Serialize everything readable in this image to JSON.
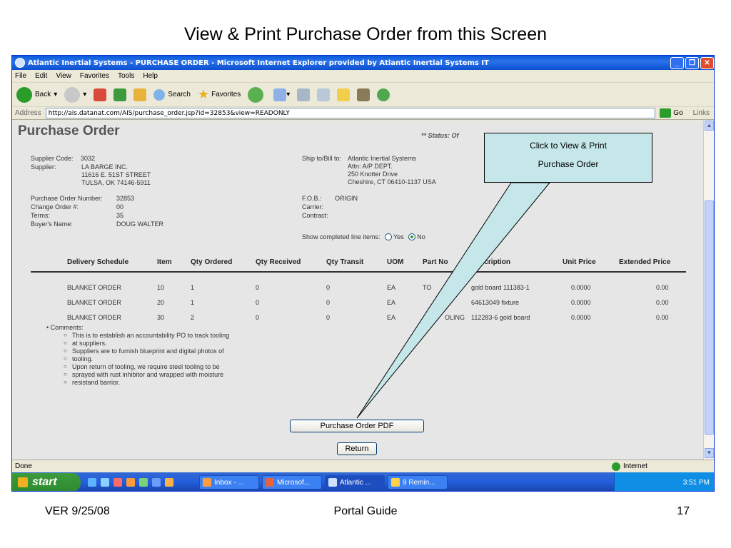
{
  "slide": {
    "title": "View & Print Purchase Order from this Screen",
    "footer_left": "VER 9/25/08",
    "footer_center": "Portal Guide",
    "footer_right": "17"
  },
  "window": {
    "title": "Atlantic Inertial Systems - PURCHASE ORDER - Microsoft Internet Explorer provided by Atlantic Inertial Systems IT"
  },
  "menu": [
    "File",
    "Edit",
    "View",
    "Favorites",
    "Tools",
    "Help"
  ],
  "toolbar": {
    "back": "Back",
    "search": "Search",
    "favorites": "Favorites"
  },
  "address": {
    "label": "Address",
    "url": "http://ais.datanat.com/AIS/purchase_order.jsp?id=32853&view=READONLY",
    "go": "Go",
    "links": "Links"
  },
  "po": {
    "heading": "Purchase Order",
    "status": "** Status: Of",
    "supplier_code_label": "Supplier Code:",
    "supplier_code": "3032",
    "supplier_label": "Supplier:",
    "supplier_lines": [
      "LA BARGE INC.",
      "11616 E. 51ST STREET",
      "TULSA, OK 74146-5911"
    ],
    "ship_label": "Ship to/Bill to:",
    "ship_lines": [
      "Atlantic Inertial Systems",
      "Attn: A/P DEPT.",
      "250 Knotter Drive",
      "Cheshire, CT 06410-1137 USA"
    ],
    "po_number_label": "Purchase Order Number:",
    "po_number": "32853",
    "change_order_label": "Change Order #:",
    "change_order": "00",
    "terms_label": "Terms:",
    "terms": "35",
    "buyer_label": "Buyer's Name:",
    "buyer": "DOUG WALTER",
    "fob_label": "F.O.B.:",
    "fob": "ORIGIN",
    "carrier_label": "Carrier:",
    "contract_label": "Contract:",
    "show_completed_label": "Show completed line items:",
    "yes": "Yes",
    "no": "No"
  },
  "table": {
    "headers": [
      "Delivery Schedule",
      "Item",
      "Qty Ordered",
      "Qty Received",
      "Qty Transit",
      "UOM",
      "Part No",
      "Description",
      "Unit Price",
      "Extended Price"
    ],
    "rows": [
      [
        "BLANKET ORDER",
        "10",
        "1",
        "0",
        "0",
        "EA",
        "TO",
        "gold board 111383-1",
        "0.0000",
        "0.00"
      ],
      [
        "BLANKET ORDER",
        "20",
        "1",
        "0",
        "0",
        "EA",
        "E",
        "64613049 fixture",
        "0.0000",
        "0.00"
      ],
      [
        "BLANKET ORDER",
        "30",
        "2",
        "0",
        "0",
        "EA",
        "OLING",
        "112283-6 gold board",
        "0.0000",
        "0.00"
      ]
    ]
  },
  "comments": {
    "label": "Comments:",
    "lines": [
      "This is to establish an accountability PO to track tooling",
      "at suppliers.",
      "Suppliers are to furnish blueprint and digital photos of",
      "tooling.",
      "Upon return of tooling, we require steel tooling to be",
      "sprayed with rust inhibitor and wrapped with moisture",
      "resistand barrior."
    ]
  },
  "buttons": {
    "pdf": "Purchase Order PDF",
    "return": "Return"
  },
  "callout": {
    "line1": "Click to View & Print",
    "line2": "Purchase Order"
  },
  "statusbar": {
    "text": "Done",
    "zone": "Internet"
  },
  "taskbar": {
    "start": "start",
    "tasks": [
      "Inbox - ...",
      "Microsof...",
      "Atlantic ...",
      "9 Remin..."
    ],
    "clock": "3:51 PM"
  }
}
